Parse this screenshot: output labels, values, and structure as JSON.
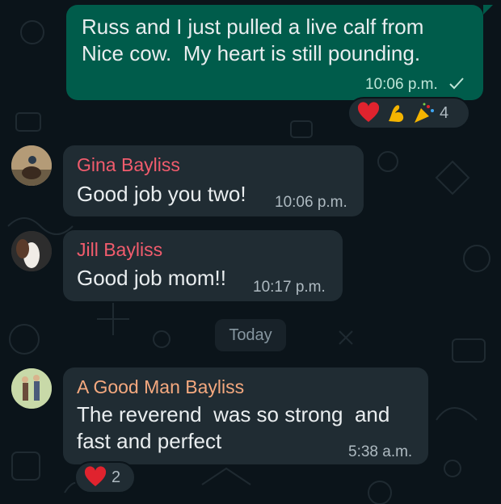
{
  "messages": [
    {
      "type": "outgoing",
      "text": "Russ and I just pulled a live calf from\nNice cow.  My heart is still pounding.",
      "time": "10:06 p.m.",
      "status_icon": "double-check-icon",
      "reactions": [
        "red-heart-icon",
        "flexed-biceps-icon",
        "party-popper-icon"
      ],
      "reaction_count": "4"
    },
    {
      "type": "incoming",
      "sender": "Gina Bayliss",
      "sender_color": "#f15c6d",
      "text": "Good job you two!",
      "time": "10:06 p.m."
    },
    {
      "type": "incoming",
      "sender": "Jill Bayliss",
      "sender_color": "#f15c6d",
      "text": "Good job mom!!",
      "time": "10:17 p.m."
    },
    {
      "type": "incoming",
      "sender": "A Good Man Bayliss",
      "sender_color": "#f5a97f",
      "text": "The reverend  was so strong  and\nfast and perfect",
      "time": "5:38 a.m.",
      "reactions": [
        "red-heart-icon"
      ],
      "reaction_count": "2"
    }
  ],
  "day_separator": "Today",
  "colors": {
    "background": "#0b141a",
    "outgoing_bubble": "#005c4b",
    "incoming_bubble": "#202c33"
  }
}
